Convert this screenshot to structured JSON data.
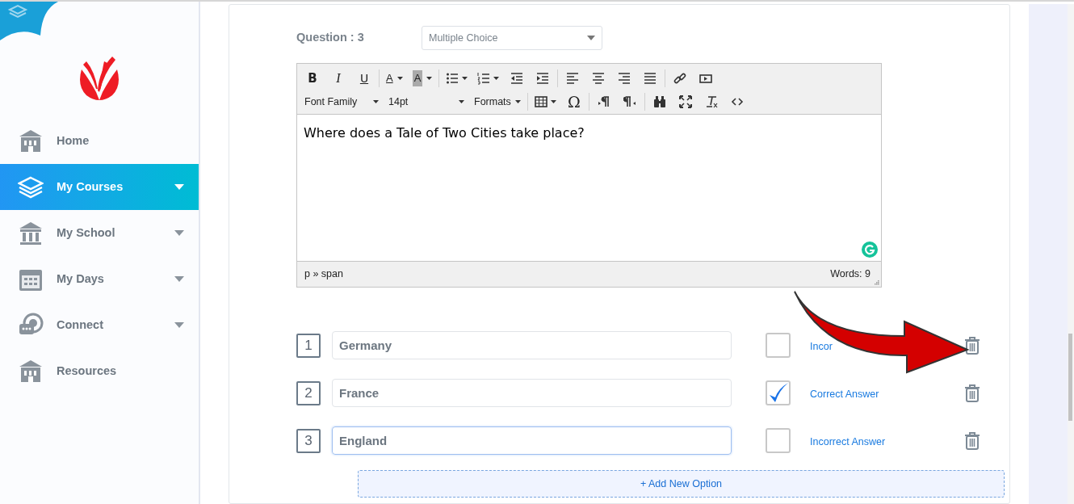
{
  "sidebar": {
    "items": [
      {
        "label": "Home",
        "selected": false,
        "expandable": false
      },
      {
        "label": "My Courses",
        "selected": true,
        "expandable": true
      },
      {
        "label": "My School",
        "selected": false,
        "expandable": true
      },
      {
        "label": "My Days",
        "selected": false,
        "expandable": true
      },
      {
        "label": "Connect",
        "selected": false,
        "expandable": true
      },
      {
        "label": "Resources",
        "selected": false,
        "expandable": false
      }
    ]
  },
  "question": {
    "label": "Question : 3",
    "type_select": {
      "value": "Multiple Choice"
    }
  },
  "editor": {
    "toolbar": {
      "format_buttons": [
        "B",
        "I",
        "U"
      ],
      "color_buttons": [
        "A",
        "A"
      ],
      "dropdowns": [
        "Font Family",
        "14pt",
        "Formats"
      ],
      "special_char": "Ω"
    },
    "content": "Where does a Tale of Two Cities take place?",
    "path": "p » span",
    "word_count": "Words: 9"
  },
  "options": [
    {
      "number": "1",
      "value": "Germany",
      "checked": false,
      "status": "Incor",
      "focused": false
    },
    {
      "number": "2",
      "value": "France",
      "checked": true,
      "status": "Correct Answer",
      "focused": false
    },
    {
      "number": "3",
      "value": "England",
      "checked": false,
      "status": "Incorrect Answer",
      "focused": true
    }
  ],
  "add_option": {
    "label": "+ Add New Option"
  }
}
